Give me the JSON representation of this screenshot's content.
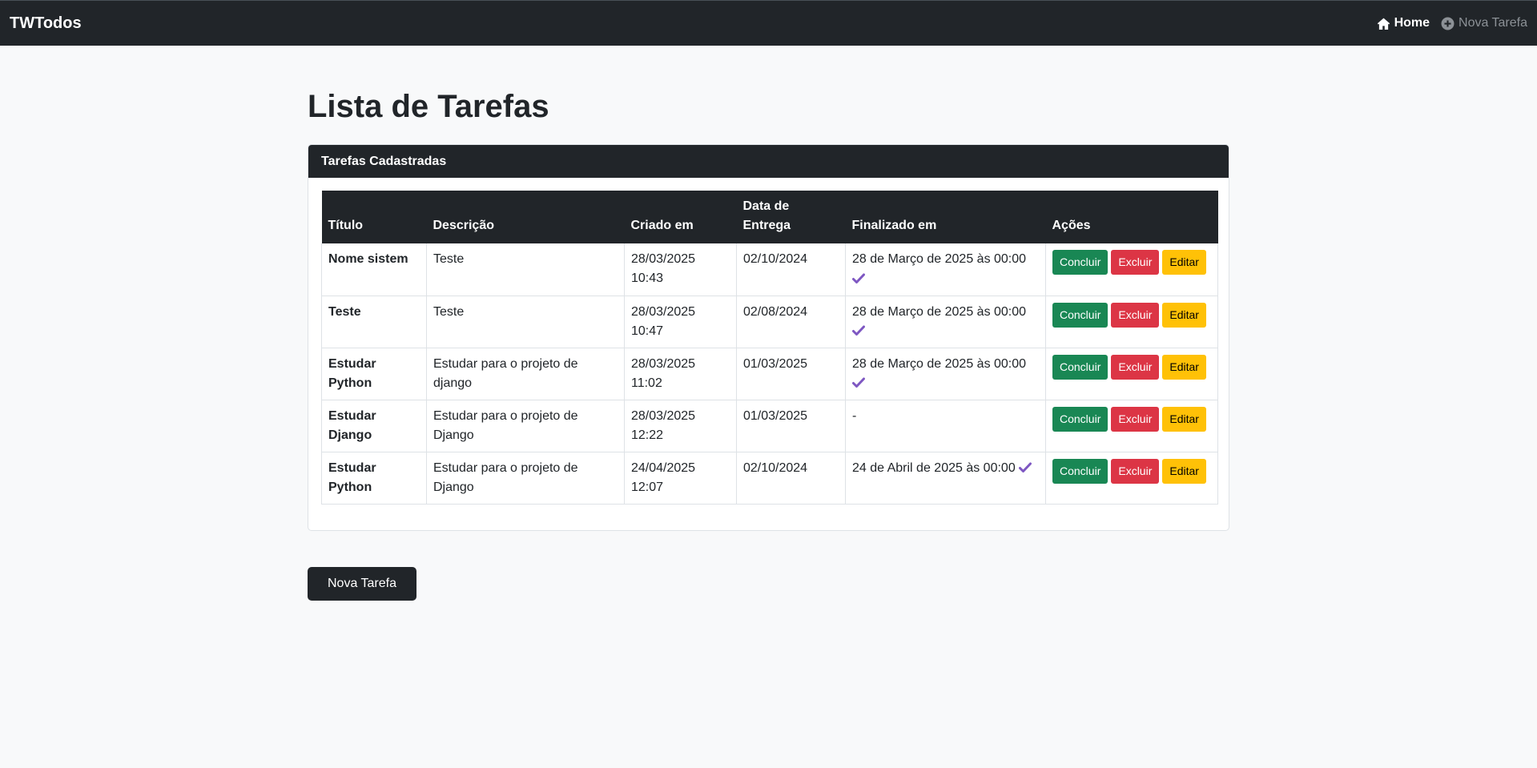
{
  "navbar": {
    "brand": "TWTodos",
    "links": [
      {
        "label": "Home",
        "icon": "home-icon"
      },
      {
        "label": "Nova Tarefa",
        "icon": "plus-circle-icon"
      }
    ]
  },
  "page": {
    "title": "Lista de Tarefas",
    "card_header": "Tarefas Cadastradas",
    "new_task_button": "Nova Tarefa"
  },
  "table": {
    "headers": [
      "Título",
      "Descrição",
      "Criado em",
      "Data de Entrega",
      "Finalizado em",
      "Ações"
    ],
    "rows": [
      {
        "titulo": "Nome sistem",
        "descricao": "Teste",
        "criado": "28/03/2025 10:43",
        "entrega": "02/10/2024",
        "finalizado": "28 de Março de 2025 às 00:00",
        "done": true
      },
      {
        "titulo": "Teste",
        "descricao": "Teste",
        "criado": "28/03/2025 10:47",
        "entrega": "02/08/2024",
        "finalizado": "28 de Março de 2025 às 00:00",
        "done": true
      },
      {
        "titulo": "Estudar Python",
        "descricao": "Estudar para o projeto de django",
        "criado": "28/03/2025 11:02",
        "entrega": "01/03/2025",
        "finalizado": "28 de Março de 2025 às 00:00",
        "done": true
      },
      {
        "titulo": "Estudar Django",
        "descricao": "Estudar para o projeto de Django",
        "criado": "28/03/2025 12:22",
        "entrega": "01/03/2025",
        "finalizado": "-",
        "done": false
      },
      {
        "titulo": "Estudar Python",
        "descricao": "Estudar para o projeto de Django",
        "criado": "24/04/2025 12:07",
        "entrega": "02/10/2024",
        "finalizado": "24 de Abril de 2025 às 00:00",
        "done": true
      }
    ],
    "actions": {
      "complete": "Concluir",
      "delete": "Excluir",
      "edit": "Editar"
    }
  },
  "colors": {
    "navbar": "#212529",
    "success": "#198754",
    "danger": "#dc3545",
    "warning": "#ffc107",
    "check": "#7e57c2"
  }
}
